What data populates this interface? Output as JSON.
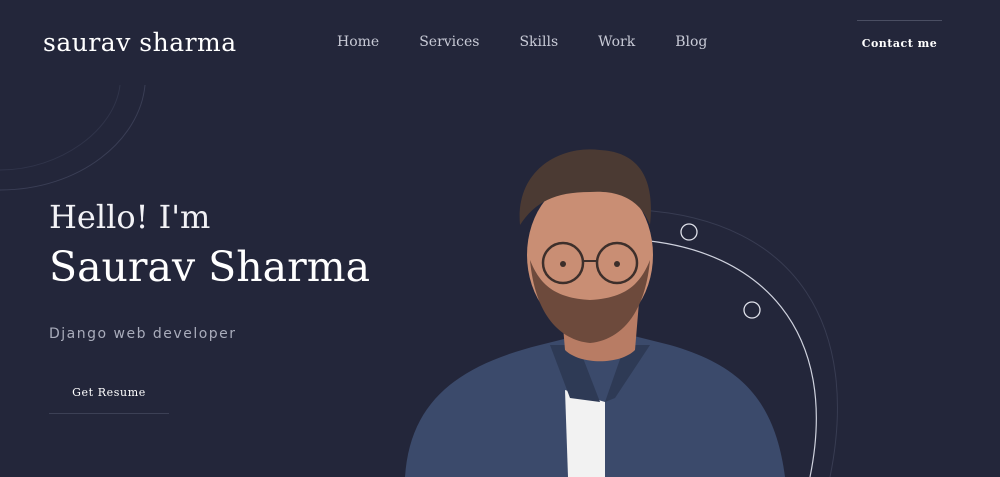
{
  "header": {
    "logo": "saurav sharma",
    "nav": [
      {
        "label": "Home"
      },
      {
        "label": "Services"
      },
      {
        "label": "Skills"
      },
      {
        "label": "Work"
      },
      {
        "label": "Blog"
      }
    ],
    "contact_label": "Contact me"
  },
  "hero": {
    "greeting": "Hello! I'm",
    "name": "Saurav Sharma",
    "role": "Django web developer",
    "resume_label": "Get Resume"
  },
  "colors": {
    "background": "#23263a",
    "text": "#ffffff",
    "muted": "#a9acbb",
    "shirt": "#3a4a6e"
  }
}
